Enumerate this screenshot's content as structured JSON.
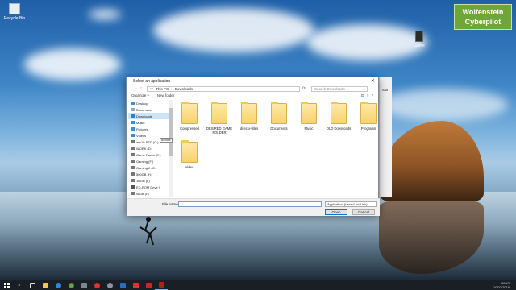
{
  "desktop": {
    "icons": [
      {
        "label": "Recycle Bin"
      },
      {
        "label": "Game"
      }
    ],
    "brand_line1": "Wolfenstein",
    "brand_line2": "Cyberpilot",
    "colors": {
      "brand": "#6fa63a"
    }
  },
  "dialog": {
    "title": "Select an application",
    "close_glyph": "✕",
    "breadcrumb": [
      "This PC",
      "Downloads"
    ],
    "search_placeholder": "Search Downloads",
    "toolbar": {
      "organize": "Organize ▾",
      "new_folder": "New folder"
    },
    "nav_items": [
      {
        "label": "Desktop",
        "icon": "desktop-icon"
      },
      {
        "label": "Documents",
        "icon": "documents-icon"
      },
      {
        "label": "Downloads",
        "icon": "downloads-icon",
        "selected": true
      },
      {
        "label": "Music",
        "icon": "music-icon"
      },
      {
        "label": "Pictures",
        "icon": "pictures-icon"
      },
      {
        "label": "Videos",
        "icon": "videos-icon"
      },
      {
        "label": "win10 SSD (C:)",
        "icon": "drive-icon"
      },
      {
        "label": "WORK (D:)",
        "icon": "drive-icon"
      },
      {
        "label": "Game Packs (E:)",
        "icon": "drive-icon"
      },
      {
        "label": "Gaming (F:)",
        "icon": "drive-icon"
      },
      {
        "label": "Gaming 2 (G:)",
        "icon": "drive-icon"
      },
      {
        "label": "500GB (H:)",
        "icon": "drive-icon"
      },
      {
        "label": "1BGB (I:)",
        "icon": "drive-icon"
      },
      {
        "label": "ED-ROM Drive (",
        "icon": "cd-icon"
      },
      {
        "label": "WGB (I:)",
        "icon": "drive-icon"
      }
    ],
    "tooltip": "Browse",
    "folders": [
      {
        "name": "Compressed"
      },
      {
        "name": "DESIRED GAME FOLDER"
      },
      {
        "name": "directx-titles"
      },
      {
        "name": "Documents"
      },
      {
        "name": "Music"
      },
      {
        "name": "OLD Downloads"
      },
      {
        "name": "Programs"
      },
      {
        "name": "Video"
      }
    ],
    "file_name_label": "File name:",
    "file_name_value": "",
    "file_type": "Application (*.exe;*.url;*.lnk)",
    "open_label": "Open",
    "cancel_label": "Cancel"
  },
  "behind_window": {
    "text": "Add"
  },
  "taskbar": {
    "time": "09:42",
    "date": "10/07/2019"
  }
}
